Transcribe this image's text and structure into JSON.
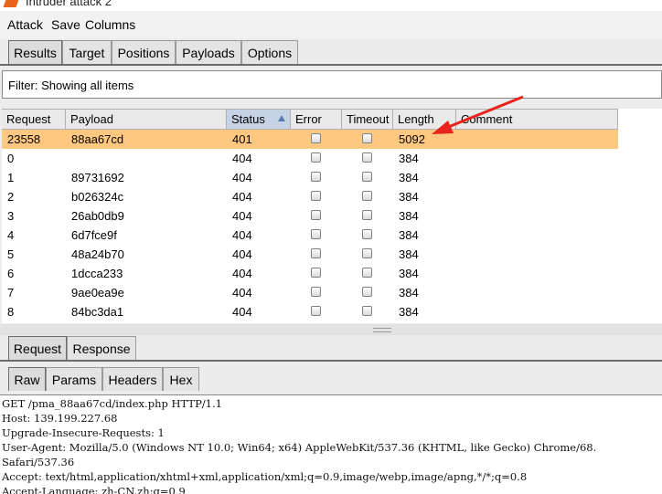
{
  "window": {
    "title": "Intruder attack 2"
  },
  "menu": [
    "Attack",
    "Save",
    "Columns"
  ],
  "main_tabs": [
    "Results",
    "Target",
    "Positions",
    "Payloads",
    "Options"
  ],
  "filter": "Filter: Showing all items",
  "table": {
    "columns": [
      "Request",
      "Payload",
      "Status",
      "Error",
      "Timeout",
      "Length",
      "Comment"
    ],
    "rows": [
      {
        "request": "23558",
        "payload": "88aa67cd",
        "status": "401",
        "length": "5092",
        "selected": true
      },
      {
        "request": "0",
        "payload": "",
        "status": "404",
        "length": "384"
      },
      {
        "request": "1",
        "payload": "89731692",
        "status": "404",
        "length": "384"
      },
      {
        "request": "2",
        "payload": "b026324c",
        "status": "404",
        "length": "384"
      },
      {
        "request": "3",
        "payload": "26ab0db9",
        "status": "404",
        "length": "384"
      },
      {
        "request": "4",
        "payload": "6d7fce9f",
        "status": "404",
        "length": "384"
      },
      {
        "request": "5",
        "payload": "48a24b70",
        "status": "404",
        "length": "384"
      },
      {
        "request": "6",
        "payload": "1dcca233",
        "status": "404",
        "length": "384"
      },
      {
        "request": "7",
        "payload": "9ae0ea9e",
        "status": "404",
        "length": "384"
      },
      {
        "request": "8",
        "payload": "84bc3da1",
        "status": "404",
        "length": "384"
      }
    ]
  },
  "reqresp_tabs": [
    "Request",
    "Response"
  ],
  "view_tabs": [
    "Raw",
    "Params",
    "Headers",
    "Hex"
  ],
  "raw_lines": [
    "GET /pma_88aa67cd/index.php HTTP/1.1",
    "Host: 139.199.227.68",
    "Upgrade-Insecure-Requests: 1",
    "User-Agent: Mozilla/5.0 (Windows NT 10.0; Win64; x64) AppleWebKit/537.36 (KHTML, like Gecko) Chrome/68.",
    "Safari/537.36",
    "Accept: text/html,application/xhtml+xml,application/xml;q=0.9,image/webp,image/apng,*/*;q=0.8",
    "Accept-Language: zh-CN,zh;q=0.9"
  ],
  "colors": {
    "selected_row": "#ffc880",
    "annotation_arrow": "#e8231c",
    "sorted_header": "#c6d3e4"
  }
}
